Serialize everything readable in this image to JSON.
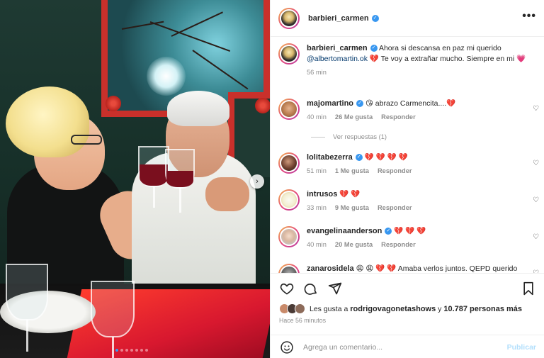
{
  "post": {
    "author": "barbieri_carmen",
    "caption_text": "Ahora si descansa en paz mi querido",
    "caption_mention": "@albertomartin.ok",
    "caption_rest": "💔 Te voy a extrañar mucho. Siempre en mi 💗",
    "caption_time": "56 min"
  },
  "header": {
    "username": "barbieri_carmen",
    "verified_mark": "✓",
    "more_label": "•••"
  },
  "comments": [
    {
      "username": "majomartino",
      "verified": true,
      "text": "😘 abrazo Carmencita....💔",
      "time": "40 min",
      "likes": "26 Me gusta",
      "reply": "Responder"
    },
    {
      "username": "lolitabezerra",
      "verified": true,
      "text": "💔 💔 💔 💔",
      "time": "51 min",
      "likes": "1 Me gusta",
      "reply": "Responder"
    },
    {
      "username": "intrusos",
      "verified": false,
      "text": "💔 💔",
      "time": "33 min",
      "likes": "9 Me gusta",
      "reply": "Responder"
    },
    {
      "username": "evangelinaanderson",
      "verified": true,
      "text": "💔 💔 💔",
      "time": "40 min",
      "likes": "20 Me gusta",
      "reply": "Responder"
    },
    {
      "username": "zanarosidela",
      "verified": false,
      "text": "😩 😩 💔 💔 Amaba verlos juntos. QEPD querido",
      "time": "",
      "likes": "",
      "reply": ""
    }
  ],
  "replies": {
    "label": "Ver respuestas (1)"
  },
  "likes": {
    "prefix": "Les gusta a",
    "user": "rodrigovagonetashows",
    "middle": "y",
    "count": "10.787 personas más"
  },
  "timestamp": "Hace 56 minutos",
  "comment_input": {
    "placeholder": "Agrega un comentario...",
    "post_label": "Publicar"
  },
  "carousel": {
    "next_glyph": "›",
    "total_slides": 7,
    "active_slide": 1
  },
  "icons": {
    "like": "heart-icon",
    "comment": "comment-icon",
    "share": "share-icon",
    "save": "bookmark-icon",
    "emoji": "emoji-icon",
    "more": "more-options-icon"
  },
  "colors": {
    "verified_blue": "#3897f0",
    "mention_blue": "#00376b",
    "publish_disabled": "#b2dffc",
    "muted_text": "#8e8e8e"
  }
}
